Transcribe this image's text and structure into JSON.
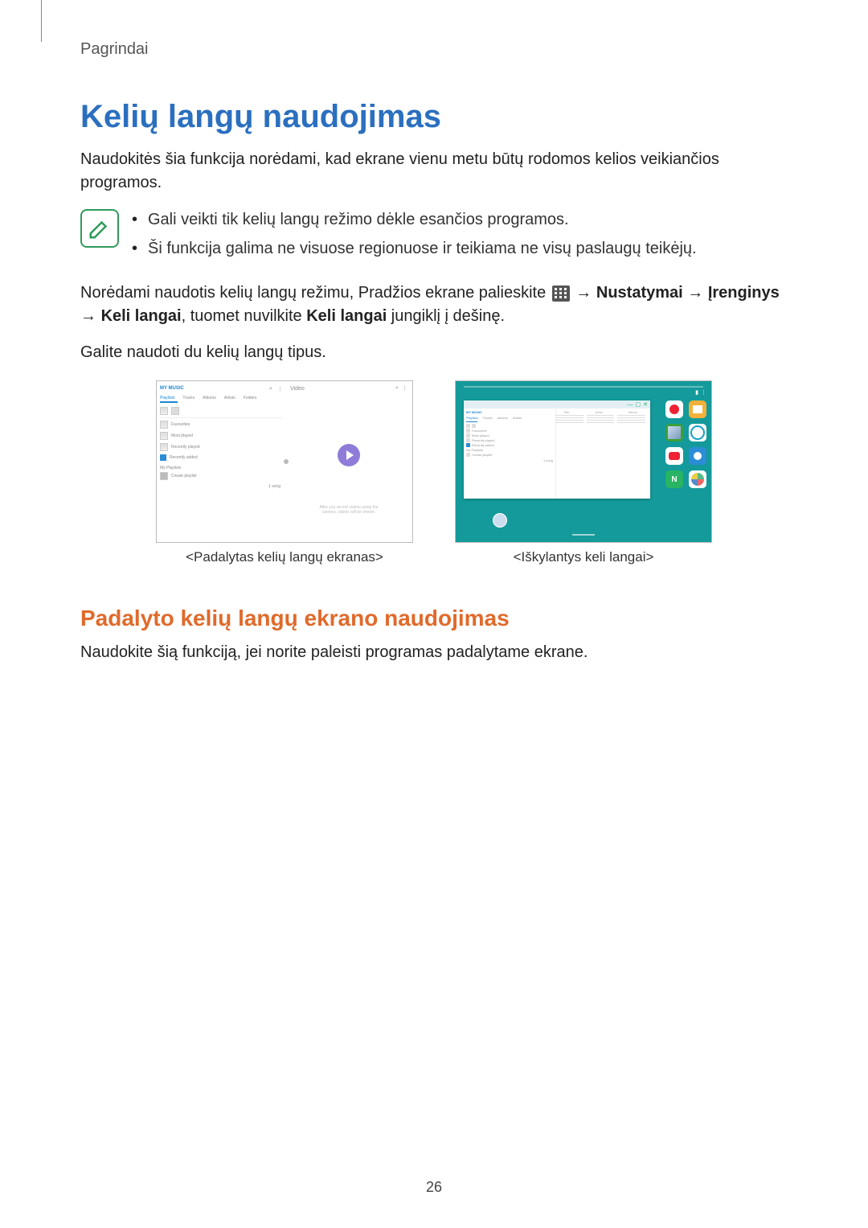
{
  "breadcrumb": "Pagrindai",
  "heading": "Kelių langų naudojimas",
  "intro": "Naudokitės šia funkcija norėdami, kad ekrane vienu metu būtų rodomos kelios veikiančios programos.",
  "notes": {
    "item1": "Gali veikti tik kelių langų režimo dėkle esančios programos.",
    "item2": "Ši funkcija galima ne visuose regionuose ir teikiama ne visų paslaugų teikėjų."
  },
  "instruct": {
    "pre": "Norėdami naudotis kelių langų režimu, Pradžios ekrane palieskite ",
    "arrow1": " → ",
    "b1": "Nustatymai",
    "arrow2": " → ",
    "b2": "Įrenginys",
    "arrow3": " → ",
    "b3": "Keli langai",
    "mid": ", tuomet nuvilkite ",
    "b4": "Keli langai",
    "post": " jungiklį į dešinę."
  },
  "types_line": "Galite naudoti du kelių langų tipus.",
  "captions": {
    "a": "<Padalytas kelių langų ekranas>",
    "b": "<Iškylantys keli langai>"
  },
  "subheading": "Padalyto kelių langų ekrano naudojimas",
  "sub_body": "Naudokite šią funkciją, jei norite paleisti programas padalytame ekrane.",
  "page_number": "26",
  "shotA": {
    "title": "MY MUSIC",
    "tabs": {
      "t1": "Playlists",
      "t2": "Tracks",
      "t3": "Albums",
      "t4": "Artists",
      "t5": "Folders"
    },
    "rows": {
      "r1": "Favourites",
      "r2": "Most played",
      "r3": "Recently played",
      "r4": "Recently added"
    },
    "section": "My Playlists",
    "row_create": "Create playlist",
    "one_song": "1 song",
    "right_title": "Video",
    "right_hint1": "After you record videos using the",
    "right_hint2": "camera, videos will be shown."
  },
  "shotB": {
    "win": {
      "title": "MY MUSIC",
      "tabs": {
        "t1": "Playlists",
        "t2": "Tracks",
        "t3": "Albums",
        "t4": "Artists"
      },
      "rows": {
        "r1": "Favourites",
        "r2": "Most played",
        "r3": "Recently played",
        "r4": "Recently added"
      },
      "section": "My Playlists",
      "row_create": "Create playlist",
      "one_song": "1 song",
      "cols": {
        "c1": "Title",
        "c2": "Artist",
        "c3": "Album"
      }
    }
  }
}
